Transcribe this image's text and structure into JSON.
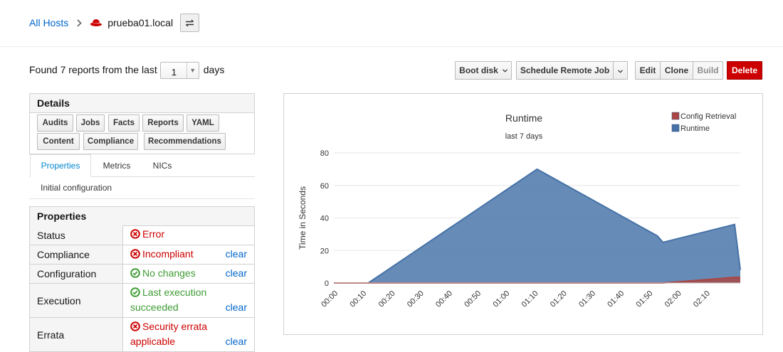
{
  "breadcrumb": {
    "root_label": "All Hosts",
    "host_name": "prueba01.local"
  },
  "reports": {
    "prefix": "Found 7 reports from the last",
    "days_value": "1",
    "suffix": "days"
  },
  "actions": {
    "boot_disk": "Boot disk",
    "schedule": "Schedule Remote Job",
    "edit": "Edit",
    "clone": "Clone",
    "build": "Build",
    "delete": "Delete"
  },
  "details": {
    "title": "Details",
    "buttons": [
      "Audits",
      "Jobs",
      "Facts",
      "Reports",
      "YAML",
      "Content",
      "Compliance",
      "Recommendations"
    ],
    "tabs": [
      "Properties",
      "Metrics",
      "NICs"
    ],
    "subtab": "Initial configuration"
  },
  "properties": {
    "title": "Properties",
    "rows": [
      {
        "label": "Status",
        "value": [
          "Error"
        ],
        "status": "error",
        "action": ""
      },
      {
        "label": "Compliance",
        "value": [
          "Incompliant"
        ],
        "status": "error",
        "action": "clear"
      },
      {
        "label": "Configuration",
        "value": [
          "No changes"
        ],
        "status": "ok",
        "action": "clear"
      },
      {
        "label": "Execution",
        "value": [
          "Last execution",
          "succeeded"
        ],
        "status": "ok",
        "action": "clear"
      },
      {
        "label": "Errata",
        "value": [
          "Security errata",
          "applicable"
        ],
        "status": "error",
        "action": "clear"
      }
    ]
  },
  "colors": {
    "link": "#0066cc",
    "danger": "#cc0000",
    "success": "#3f9c35",
    "runtime": "#4572a7",
    "config_retrieval": "#aa4643"
  },
  "chart_data": {
    "type": "area",
    "title": "Runtime",
    "subtitle": "last 7 days",
    "ylabel": "Time in Seconds",
    "xlabel": "",
    "ylim": [
      0,
      80
    ],
    "yticks": [
      0,
      20,
      40,
      60,
      80
    ],
    "xticks": [
      "00:00",
      "00:10",
      "00:20",
      "00:30",
      "00:40",
      "00:50",
      "01:00",
      "01:10",
      "01:20",
      "01:30",
      "01:40",
      "01:50",
      "02:00",
      "02:10"
    ],
    "xlim": [
      -1.5,
      140.5
    ],
    "legend": "top-right",
    "grid": true,
    "series": [
      {
        "name": "Config Retrieval",
        "color": "#aa4643",
        "x": [
          -1.5,
          10.5,
          69.5,
          113.5,
          138.5,
          140.5
        ],
        "y": [
          0,
          0,
          0,
          0,
          3.5,
          3.5
        ]
      },
      {
        "name": "Runtime",
        "color": "#4572a7",
        "x": [
          -1.5,
          10.5,
          69.5,
          111.5,
          113.5,
          138.5,
          140.5
        ],
        "y": [
          0,
          0,
          70,
          29,
          25,
          36,
          8
        ]
      }
    ]
  }
}
